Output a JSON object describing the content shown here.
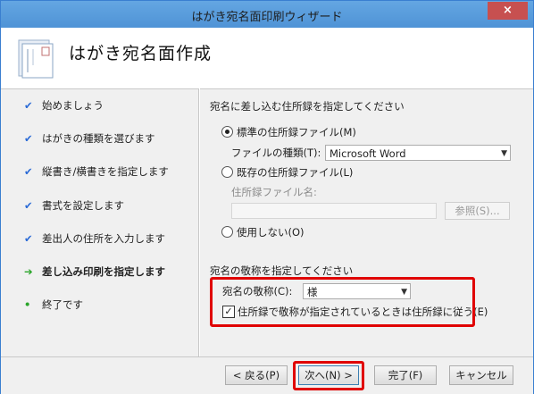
{
  "window": {
    "title": "はがき宛名面印刷ウィザード",
    "close_label": "×"
  },
  "header": {
    "title": "はがき宛名面作成"
  },
  "steps": [
    {
      "label": "始めましょう",
      "mark": "✔"
    },
    {
      "label": "はがきの種類を選びます",
      "mark": "✔"
    },
    {
      "label": "縦書き/横書きを指定します",
      "mark": "✔"
    },
    {
      "label": "書式を設定します",
      "mark": "✔"
    },
    {
      "label": "差出人の住所を入力します",
      "mark": "✔"
    },
    {
      "label": "差し込み印刷を指定します",
      "mark": "➔"
    },
    {
      "label": "終了です",
      "mark": "•"
    }
  ],
  "address_section": {
    "heading": "宛名に差し込む住所録を指定してください",
    "standard_label": "標準の住所録ファイル(M)",
    "file_type_label": "ファイルの種類(T):",
    "file_type_value": "Microsoft Word",
    "existing_label": "既存の住所録ファイル(L)",
    "address_file_name_label": "住所録ファイル名:",
    "browse_label": "参照(S)...",
    "none_label": "使用しない(O)"
  },
  "honorific_section": {
    "heading": "宛名の敬称を指定してください",
    "honorific_label": "宛名の敬称(C):",
    "honorific_value": "様",
    "follow_label": "住所録で敬称が指定されているときは住所録に従う(E)"
  },
  "buttons": {
    "back": "< 戻る(P)",
    "next": "次へ(N) >",
    "finish": "完了(F)",
    "cancel": "キャンセル"
  }
}
